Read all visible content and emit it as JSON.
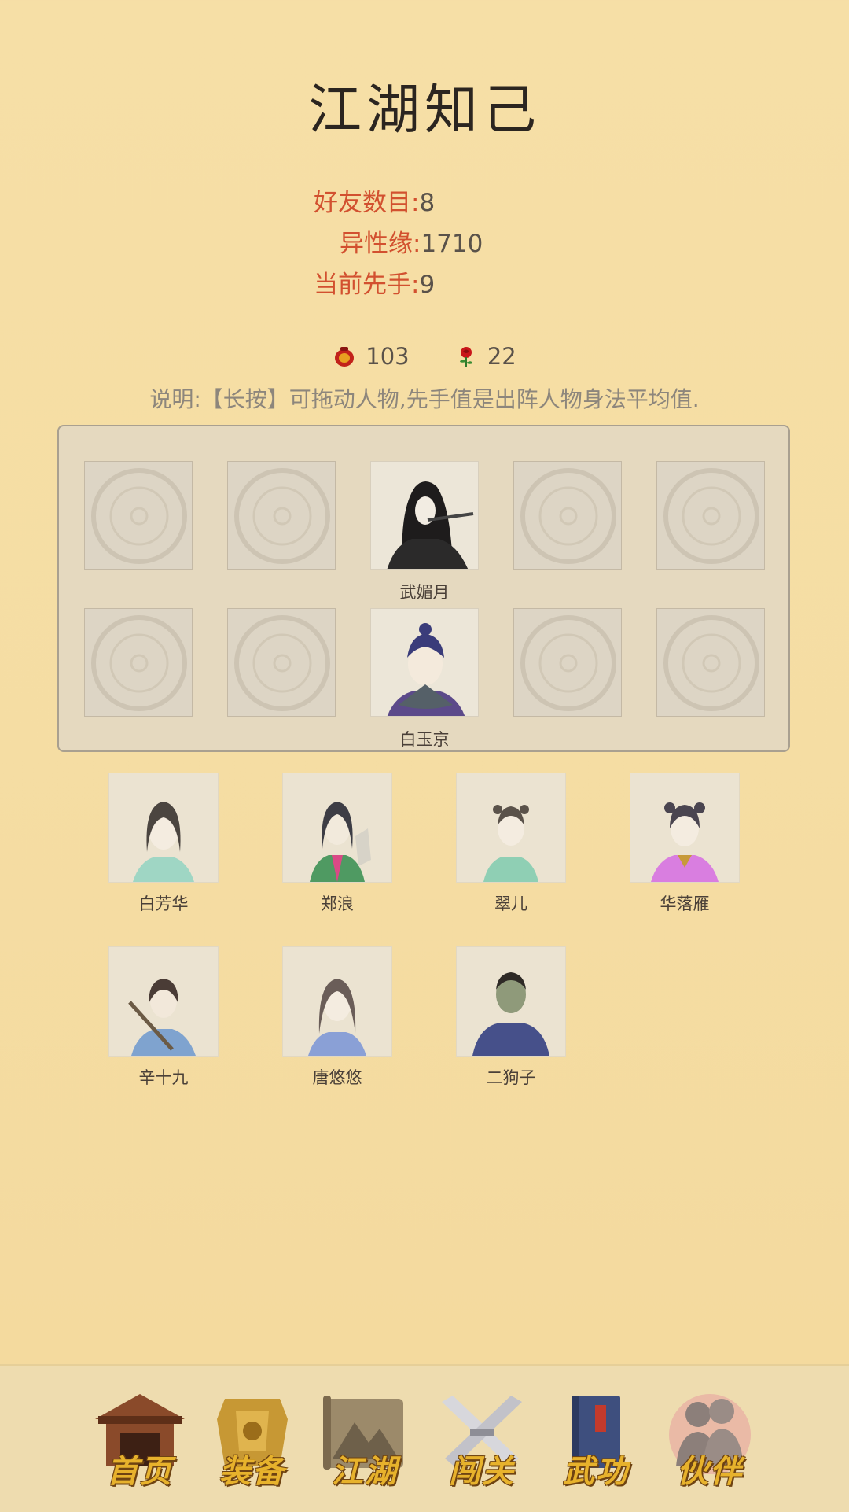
{
  "page": {
    "title": "江湖知己"
  },
  "stats": {
    "friends_label": "好友数目:",
    "friends_value": "8",
    "affinity_label": "异性缘:",
    "affinity_value": "1710",
    "initiative_label": "当前先手:",
    "initiative_value": "9"
  },
  "currency": {
    "pot": {
      "icon": "red-pot-icon",
      "value": "103"
    },
    "rose": {
      "icon": "rose-icon",
      "value": "22"
    }
  },
  "hint": "说明:【长按】可拖动人物,先手值是出阵人物身法平均值.",
  "formation": {
    "row1_filled_name": "武媚月",
    "row2_filled_name": "白玉京"
  },
  "roster": [
    {
      "name": "白芳华"
    },
    {
      "name": "郑浪"
    },
    {
      "name": "翠儿"
    },
    {
      "name": "华落雁"
    },
    {
      "name": "辛十九"
    },
    {
      "name": "唐悠悠"
    },
    {
      "name": "二狗子"
    }
  ],
  "nav": {
    "home": "首页",
    "equipment": "装备",
    "jianghu": "江湖",
    "challenge": "闯关",
    "martial": "武功",
    "partner": "伙伴",
    "active": "伙伴"
  },
  "colors": {
    "background": "#f5dca2",
    "label_red": "#d2502f",
    "nav_gold": "#e7b22c"
  }
}
